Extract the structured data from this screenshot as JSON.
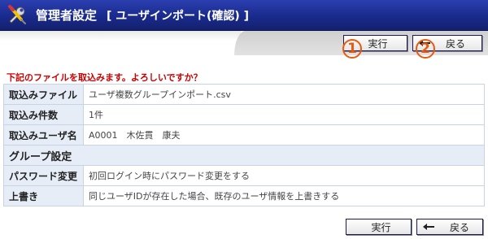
{
  "header": {
    "title": "管理者設定",
    "subtitle": "[ ユーザインポート(確認) ]",
    "icon": "tools-icon",
    "bg_color": "#1a2a8c"
  },
  "toolbar": {
    "execute_label": "実行",
    "back_label": "戻る",
    "badge_execute": "1",
    "badge_back": "2",
    "badge_color": "#e85a10"
  },
  "notice": "下記のファイルを取込みます。よろしいですか？",
  "rows": [
    {
      "label": "取込みファイル",
      "value": "ユーザ複数グループインポート.csv"
    },
    {
      "label": "取込み件数",
      "value": "1件"
    },
    {
      "label": "取込みユーザ名",
      "value": "A0001　木佐貫　康夫"
    }
  ],
  "section_title": "グループ設定",
  "settings": [
    {
      "label": "パスワード変更",
      "value": "初回ログイン時にパスワード変更をする"
    },
    {
      "label": "上書き",
      "value": "同じユーザIDが存在した場合、既存のユーザ情報を上書きする"
    }
  ],
  "footer": {
    "execute_label": "実行",
    "back_label": "戻る"
  }
}
